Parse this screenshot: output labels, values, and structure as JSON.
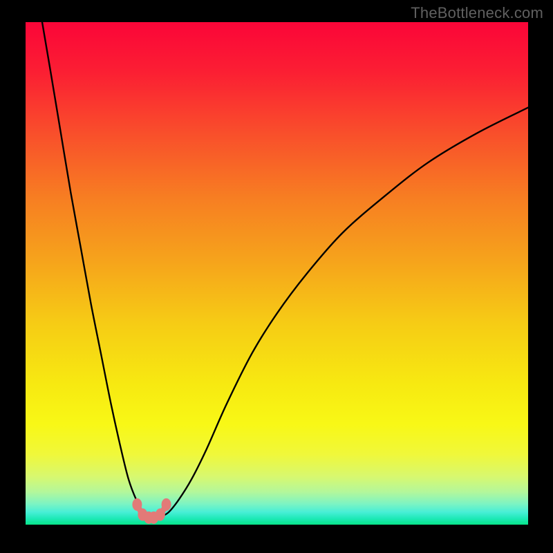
{
  "watermark": {
    "text": "TheBottleneck.com"
  },
  "chart_data": {
    "type": "line",
    "title": "",
    "xlabel": "",
    "ylabel": "",
    "xlim": [
      0,
      100
    ],
    "ylim": [
      0,
      100
    ],
    "x_optimum": 25,
    "series": [
      {
        "name": "curve-left",
        "x": [
          3.3,
          5,
          7,
          9,
          11,
          13,
          15,
          17,
          19,
          20.5,
          22,
          23.5,
          24.5
        ],
        "y": [
          100,
          90,
          78,
          66,
          55,
          44,
          34,
          24,
          15,
          9,
          5,
          2.2,
          1.4
        ]
      },
      {
        "name": "curve-right",
        "x": [
          27,
          28.5,
          30.5,
          33,
          36,
          40,
          45,
          50,
          56,
          63,
          71,
          80,
          90,
          100
        ],
        "y": [
          1.6,
          2.5,
          5,
          9,
          15,
          24,
          34,
          42,
          50,
          58,
          65,
          72,
          78,
          83
        ]
      },
      {
        "name": "trough",
        "x": [
          22.2,
          23.3,
          24.5,
          25.5,
          26.8,
          28.0
        ],
        "y": [
          4.0,
          2.0,
          1.4,
          1.4,
          2.0,
          4.0
        ]
      }
    ],
    "markers": {
      "name": "trough-markers",
      "color": "#e27a78",
      "points": [
        {
          "x": 22.2,
          "y": 4.0
        },
        {
          "x": 23.3,
          "y": 2.0
        },
        {
          "x": 24.5,
          "y": 1.4
        },
        {
          "x": 25.5,
          "y": 1.4
        },
        {
          "x": 26.8,
          "y": 2.0
        },
        {
          "x": 28.0,
          "y": 4.0
        }
      ]
    },
    "bands": [
      {
        "stop": 0.0,
        "color": "#fb0538"
      },
      {
        "stop": 0.1,
        "color": "#fb1f33"
      },
      {
        "stop": 0.22,
        "color": "#f94e2b"
      },
      {
        "stop": 0.35,
        "color": "#f77e22"
      },
      {
        "stop": 0.48,
        "color": "#f6a51b"
      },
      {
        "stop": 0.6,
        "color": "#f6cc15"
      },
      {
        "stop": 0.72,
        "color": "#f7e911"
      },
      {
        "stop": 0.8,
        "color": "#f8f816"
      },
      {
        "stop": 0.86,
        "color": "#f0f83a"
      },
      {
        "stop": 0.905,
        "color": "#d7f870"
      },
      {
        "stop": 0.935,
        "color": "#b3f79b"
      },
      {
        "stop": 0.958,
        "color": "#7ef4c2"
      },
      {
        "stop": 0.975,
        "color": "#48efd6"
      },
      {
        "stop": 0.988,
        "color": "#1de9b6"
      },
      {
        "stop": 1.0,
        "color": "#07e489"
      }
    ]
  }
}
